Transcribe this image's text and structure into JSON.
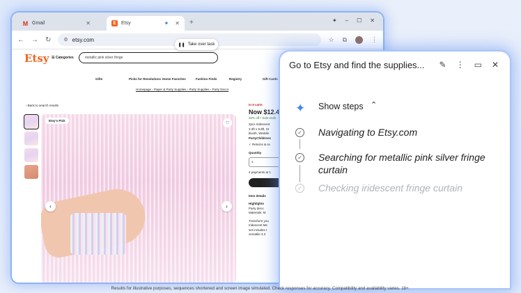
{
  "browser": {
    "tabs": [
      {
        "label": "Gmail",
        "icon": "gmail-icon"
      },
      {
        "label": "Etsy",
        "icon": "etsy-icon"
      }
    ],
    "address": "etsy.com"
  },
  "etsy": {
    "logo": "Etsy",
    "categories": "☰ Categories",
    "search_value": "metallic pink silver fringe",
    "nav": [
      "Gifts",
      "Picks for Resolutions",
      "Home Favorites",
      "Fashion Finds",
      "Registry",
      "Gift Cards"
    ],
    "breadcrumb": "Homepage › Paper & Party Supplies › Party Supplies › Party Decor",
    "back": "‹ Back to search results",
    "badge": "Etsy's Pick",
    "product": {
      "in_carts": "In 9 carts",
      "price": "Now $12.4",
      "sale": "30% off • Sale ends",
      "desc": "2pcs Iridescent",
      "desc2": "3.3ft x 9.8ft, St",
      "desc3": "Booth, Weddin",
      "shop": "PartyChildrens",
      "returns": "✓ Returns & ex",
      "qty_label": "Quantity",
      "qty_value": "1",
      "payments": "4 payments at 1",
      "item_details": "Item details",
      "highlights": "Highlights",
      "h1": "Party deco",
      "h2": "Materials: M",
      "t1": "Transform you",
      "t2": "Iridescent Me",
      "t3": "set includes t",
      "t4": "versatile 3.3"
    }
  },
  "take_over": "Take over task",
  "gemini": {
    "title": "Go to Etsy and find the supplies...",
    "show_steps": "Show steps",
    "steps": [
      {
        "text": "Navigating to Etsy.com",
        "state": "done"
      },
      {
        "text": "Searching for metallic pink silver fringe curtain",
        "state": "done"
      },
      {
        "text": "Checking iridescent fringe curtain",
        "state": "pending"
      }
    ]
  },
  "footer": "Results for illustrative purposes, sequences shortened and screen image simulated. Check responses for accuracy. Compatibility and availability varies. 18+."
}
